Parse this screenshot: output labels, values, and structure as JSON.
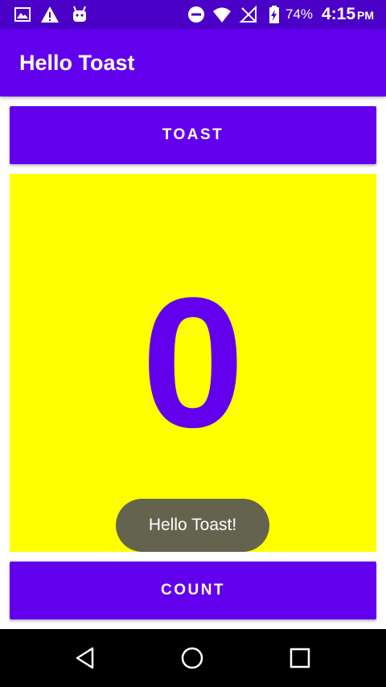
{
  "status_bar": {
    "icons_left": [
      "gallery-icon",
      "warning-icon",
      "android-icon"
    ],
    "icons_right": [
      "do-not-disturb-icon",
      "wifi-icon",
      "no-signal-icon",
      "battery-charging-icon"
    ],
    "battery_percent": "74%",
    "time": "4:15",
    "ampm": "PM"
  },
  "app_bar": {
    "title": "Hello Toast"
  },
  "main": {
    "toast_button_label": "TOAST",
    "count_value": "0",
    "count_button_label": "COUNT"
  },
  "toast": {
    "message": "Hello Toast!"
  },
  "nav_bar": {
    "icons": [
      "back-icon",
      "home-icon",
      "recents-icon"
    ]
  },
  "colors": {
    "status_bar": "#4b00c8",
    "primary": "#6200ee",
    "count_background": "#ffff00",
    "toast_background": "#64644e"
  }
}
